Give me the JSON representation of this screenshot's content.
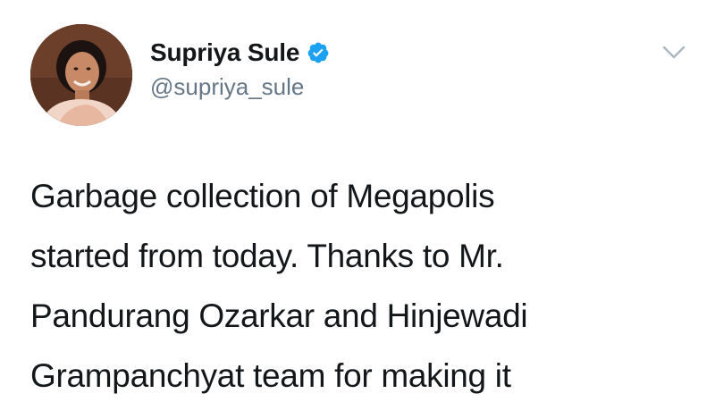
{
  "tweet": {
    "author": {
      "display_name": "Supriya Sule",
      "handle": "@supriya_sule",
      "verified": true,
      "avatar_icon": "profile-photo"
    },
    "menu_icon": "chevron-down-icon",
    "text_lines": [
      "Garbage collection of Megapolis",
      "started from today. Thanks to Mr.",
      "Pandurang Ozarkar and Hinjewadi",
      "Grampanchyat team for making it"
    ]
  },
  "colors": {
    "verified_blue": "#1da1f2",
    "text_primary": "#14171a",
    "text_secondary": "#657786",
    "chevron": "#aab8c2"
  }
}
